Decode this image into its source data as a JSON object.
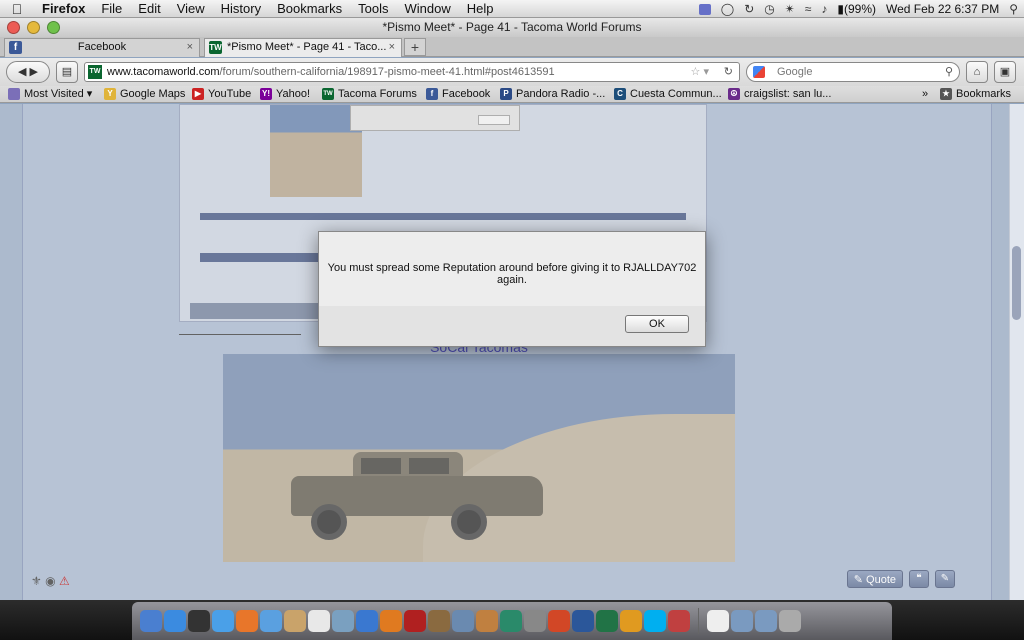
{
  "menubar": {
    "app": "Firefox",
    "items": [
      "File",
      "Edit",
      "View",
      "History",
      "Bookmarks",
      "Tools",
      "Window",
      "Help"
    ],
    "battery": "(99%)",
    "datetime": "Wed Feb 22  6:37 PM"
  },
  "window": {
    "title": "*Pismo Meet* - Page 41 - Tacoma World Forums"
  },
  "tabs": [
    {
      "label": "Facebook",
      "icon": "facebook-icon"
    },
    {
      "label": "*Pismo Meet* - Page 41 - Taco...",
      "icon": "tacoma-world-icon"
    }
  ],
  "tab_new": "+",
  "tab_close": "×",
  "nav": {
    "url_host": "www.tacomaworld.com",
    "url_rest": "/forum/southern-california/198917-pismo-meet-41.html#post4613591",
    "search_placeholder": "Google"
  },
  "bookmarks": [
    {
      "label": "Most Visited ▾"
    },
    {
      "label": "Google Maps"
    },
    {
      "label": "YouTube"
    },
    {
      "label": "Yahoo!"
    },
    {
      "label": "Tacoma Forums"
    },
    {
      "label": "Facebook"
    },
    {
      "label": "Pandora Radio -..."
    },
    {
      "label": "Cuesta Commun..."
    },
    {
      "label": "craigslist: san lu..."
    },
    {
      "label": "Bookmarks"
    }
  ],
  "bookmarks_more": "»",
  "page": {
    "heading": "SoCal Tacomas",
    "quote_label": "Quote"
  },
  "dialog": {
    "message": "You must spread some Reputation around before giving it to RJALLDAY702 again.",
    "ok_label": "OK"
  },
  "dock_icons": [
    "finder-icon",
    "app-store-icon",
    "dashboard-icon",
    "safari-icon",
    "firefox-icon",
    "ichat-icon",
    "contacts-icon",
    "ical-icon",
    "preview-icon",
    "itunes-icon",
    "vlc-icon",
    "photo-booth-icon",
    "imovie-icon",
    "iphoto-icon",
    "garageband-icon",
    "time-machine-icon",
    "system-preferences-icon",
    "powerpoint-icon",
    "word-icon",
    "excel-icon",
    "outlook-icon",
    "skype-icon",
    "messenger-icon",
    "document-icon",
    "applications-icon",
    "downloads-icon",
    "trash-icon"
  ],
  "colors": {
    "dialog_bg": "#ededed",
    "link": "#1a1aa6",
    "forum_bar": "#3d4f7e",
    "brand_tw": "#0a6630",
    "facebook": "#3b5998"
  }
}
